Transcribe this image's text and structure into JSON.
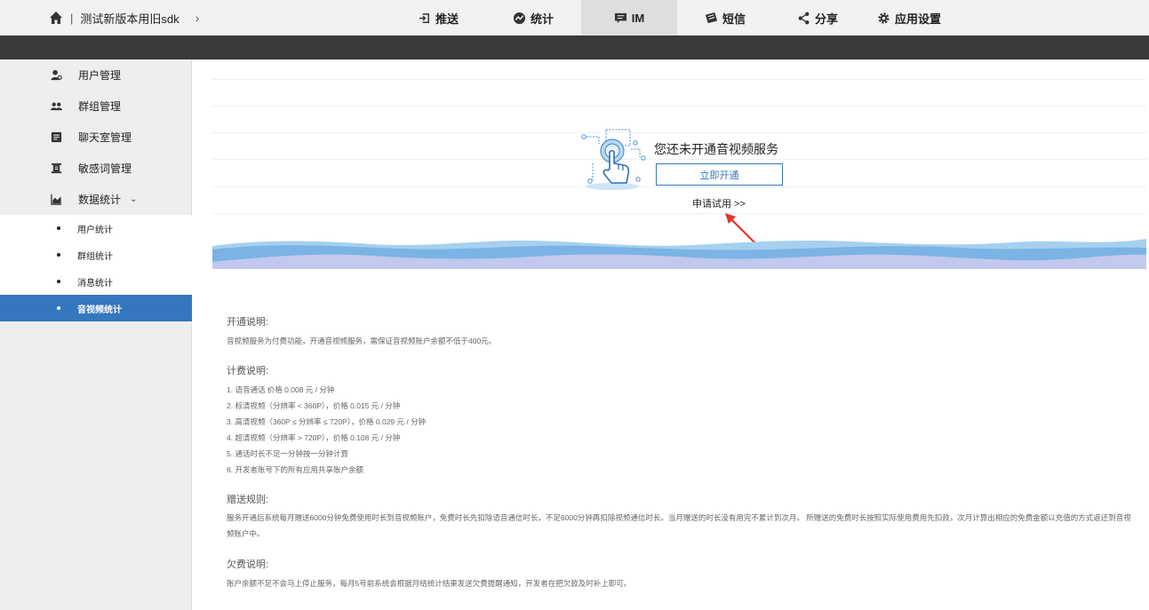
{
  "header": {
    "app_name": "测试新版本用旧sdk",
    "separator": "|",
    "chevron": "›",
    "nav": [
      {
        "label": "推送",
        "icon": "login-icon"
      },
      {
        "label": "统计",
        "icon": "chart-icon"
      },
      {
        "label": "IM",
        "icon": "chat-icon",
        "active": true
      },
      {
        "label": "短信",
        "icon": "sms-icon"
      },
      {
        "label": "分享",
        "icon": "share-icon"
      },
      {
        "label": "应用设置",
        "icon": "gear-icon"
      }
    ]
  },
  "sidebar": {
    "items": [
      {
        "label": "用户管理",
        "icon": "user-icon"
      },
      {
        "label": "群组管理",
        "icon": "group-icon"
      },
      {
        "label": "聊天室管理",
        "icon": "chatroom-icon"
      },
      {
        "label": "敏感词管理",
        "icon": "filter-icon"
      },
      {
        "label": "数据统计",
        "icon": "stats-icon",
        "expanded": true
      }
    ],
    "caret": "⌄",
    "sub_items": [
      {
        "label": "用户统计"
      },
      {
        "label": "群组统计"
      },
      {
        "label": "消息统计"
      },
      {
        "label": "音视频统计",
        "active": true
      }
    ],
    "accent_color": "#3477bd"
  },
  "promo": {
    "title": "您还未开通音视频服务",
    "open_button": "立即开通",
    "trial_link": "申请试用 >>"
  },
  "sections": {
    "open": {
      "title": "开通说明:",
      "text": "音视频服务为付费功能，开通音视频服务，需保证音视频账户余额不低于400元。"
    },
    "billing": {
      "title": "计费说明:",
      "items": [
        "1. 语音通话 价格 0.008 元 / 分钟",
        "2. 标清视频（分辨率 < 360P），价格 0.015 元 / 分钟",
        "3. 高清视频（360P ≤ 分辨率 ≤ 720P），价格 0.029 元 / 分钟",
        "4. 超清视频（分辨率 > 720P），价格 0.108 元 / 分钟",
        "5. 通话时长不足一分钟按一分钟计算",
        "6. 开发者账号下的所有应用共享账户余额"
      ]
    },
    "gift": {
      "title": "赠送规则:",
      "text": "服务开通后系统每月赠送6000分钟免费使用时长到音视频账户，免费时长先扣除语音通信时长，不足6000分钟再扣除视频通信时长。当月赠送的时长没有用完不累计到次月。 所赠送的免费时长按照实际使用费用先扣款，次月计算出相应的免费金额以充值的方式返还到音视频账户中。"
    },
    "debt": {
      "title": "欠费说明:",
      "text": "账户余额不足不会马上停止服务，每月5号前系统会根据月结统计结果发送欠费提醒通知，开发者在把欠款及时补上即可。"
    }
  }
}
